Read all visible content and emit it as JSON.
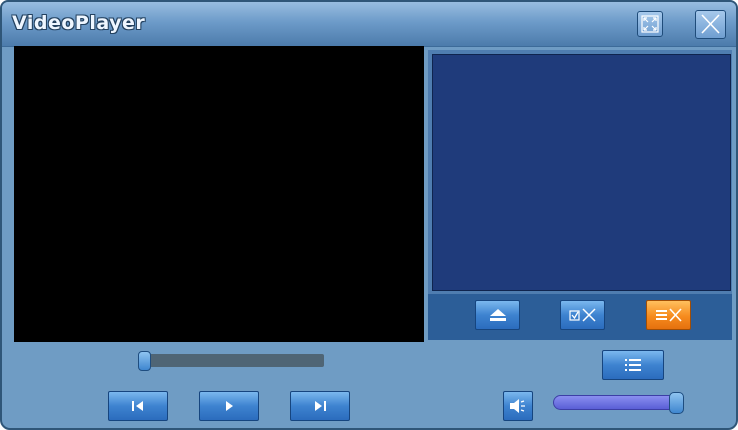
{
  "window": {
    "title": "VideoPlayer"
  },
  "titlebar": {
    "fullscreen_icon": "fullscreen-icon",
    "close_icon": "close-icon"
  },
  "playlist": {
    "items": []
  },
  "playlist_toolbar": {
    "buttons": [
      {
        "icon": "eject-icon"
      },
      {
        "icon": "remove-checked-icon"
      },
      {
        "icon": "clear-list-icon",
        "color": "#f68b1e"
      }
    ]
  },
  "controls": {
    "seek_progress": 0.0,
    "volume_level": 1.0,
    "buttons": [
      {
        "icon": "previous-icon"
      },
      {
        "icon": "play-icon"
      },
      {
        "icon": "next-icon"
      },
      {
        "icon": "playlist-icon"
      },
      {
        "icon": "speaker-icon"
      }
    ]
  },
  "colors": {
    "accent": "#3e83d0",
    "video_bg": "#000000",
    "playlist_bg": "#1f3b7b",
    "window_bg": "#6f9cc4"
  }
}
